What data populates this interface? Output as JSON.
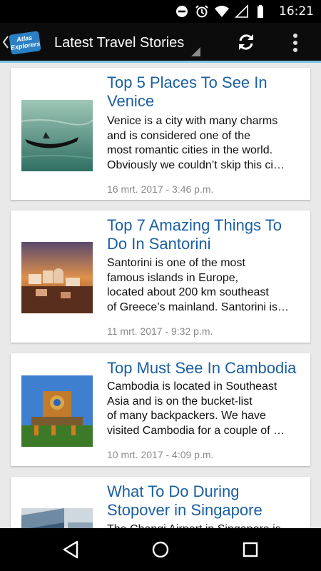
{
  "status_bar": {
    "time": "16:21",
    "icons": [
      "do-not-disturb-icon",
      "alarm-icon",
      "wifi-icon",
      "signal-icon",
      "battery-icon"
    ]
  },
  "app_bar": {
    "logo_line1": "Atlas",
    "logo_line2": "Explorers",
    "title": "Latest Travel Stories",
    "actions": [
      "refresh-icon",
      "overflow-menu-icon"
    ]
  },
  "stories": [
    {
      "title_lines": [
        "Top 5 Places To See In",
        "Venice"
      ],
      "excerpt_lines": [
        "Venice is a city with many charms",
        "and is considered one of the",
        "most romantic cities in the world.",
        "Obviously we couldn’t skip this ci…"
      ],
      "date": "16 mrt. 2017 - 3:46 p.m."
    },
    {
      "title_lines": [
        "Top 7 Amazing Things To",
        "Do In Santorini"
      ],
      "excerpt_lines": [
        "Santorini is one of the most",
        "famous islands in Europe,",
        "located about 200 km southeast",
        "of Greece’s mainland. Santorini is…"
      ],
      "date": "11 mrt. 2017 - 9:32 p.m."
    },
    {
      "title_lines": [
        "Top Must See In Cambodia"
      ],
      "excerpt_lines": [
        "Cambodia is located in Southeast",
        "Asia and is on the bucket-list",
        "of many backpackers. We have",
        "visited Cambodia for a couple of …"
      ],
      "date": "10 mrt. 2017 - 4:09 p.m."
    },
    {
      "title_lines": [
        "What To Do During",
        "Stopover in Singapore"
      ],
      "excerpt_lines": [
        "The Changi Airport in Singapore is"
      ],
      "date": ""
    }
  ],
  "nav_bar": [
    "back-nav-icon",
    "home-nav-icon",
    "recents-nav-icon"
  ],
  "colors": {
    "title_link": "#1b5fa3",
    "app_bar_bg": "#0c0c0c",
    "app_bar_accent": "#7dc2e8",
    "feed_bg": "#e9e9e9",
    "date_text": "#8a8a8a"
  }
}
